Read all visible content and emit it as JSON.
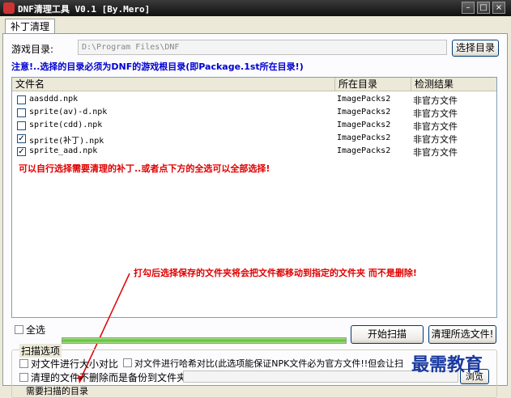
{
  "window": {
    "title": "DNF清理工具 V0.1 [By.Mero]",
    "minimize": "–",
    "maximize": "□",
    "close": "×"
  },
  "tabs": [
    {
      "label": "补丁清理"
    }
  ],
  "directory": {
    "label": "游戏目录:",
    "value": "D:\\Program Files\\DNF",
    "browse_button": "选择目录"
  },
  "notice": "注意!..选择的目录必须为DNF的游戏根目录(即Package.1st所在目录!)",
  "file_list": {
    "columns": [
      "文件名",
      "所在目录",
      "检测结果"
    ],
    "rows": [
      {
        "name": "aasddd.npk",
        "dir": "ImagePacks2",
        "result": "非官方文件",
        "checked": false
      },
      {
        "name": "sprite(av)-d.npk",
        "dir": "ImagePacks2",
        "result": "非官方文件",
        "checked": false
      },
      {
        "name": "sprite(cdd).npk",
        "dir": "ImagePacks2",
        "result": "非官方文件",
        "checked": false
      },
      {
        "name": "sprite(补丁).npk",
        "dir": "ImagePacks2",
        "result": "非官方文件",
        "checked": true
      },
      {
        "name": "sprite_aad.npk",
        "dir": "ImagePacks2",
        "result": "非官方文件",
        "checked": true
      }
    ],
    "hint": "可以自行选择需要清理的补丁..或者点下方的全选可以全部选择!",
    "annotation": "打勾后选择保存的文件夹将会把文件都移动到指定的文件夹 而不是删除!"
  },
  "select_all": {
    "label": "全选",
    "checked": false
  },
  "progress": {
    "value": 1.0
  },
  "buttons": {
    "start_scan": "开始扫描",
    "clean_selected": "清理所选文件!",
    "browse": "浏览"
  },
  "scan_options": {
    "title": "扫描选项",
    "size_compare": "对文件进行大小对比",
    "hash_compare": "对文件进行哈希对比(此选项能保证NPK文件必为官方文件!!但会让扫",
    "backup_instead_delete": "清理的文件不删除而是备份到文件夹",
    "cut_off_text": "需要扫描的目录"
  },
  "colors": {
    "notice": "#0000d0",
    "warning": "#e00000",
    "progress": "#5fbf35"
  },
  "watermark": "最需教育"
}
